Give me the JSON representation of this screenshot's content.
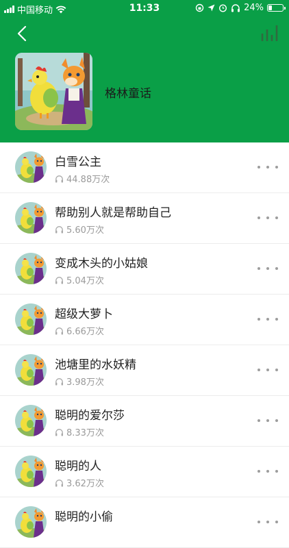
{
  "status_bar": {
    "carrier": "中国移动",
    "time": "11:33",
    "battery": "24%",
    "battery_level": 0.24
  },
  "header": {
    "album_title": "格林童话",
    "back_icon": "chevron-left-icon",
    "playing_icon": "equalizer-icon"
  },
  "colors": {
    "header_bg": "#0a9f47"
  },
  "tracks": [
    {
      "title": "白雪公主",
      "plays": "44.88万次"
    },
    {
      "title": "帮助别人就是帮助自己",
      "plays": "5.60万次"
    },
    {
      "title": "变成木头的小姑娘",
      "plays": "5.04万次"
    },
    {
      "title": "超级大萝卜",
      "plays": "6.66万次"
    },
    {
      "title": "池塘里的水妖精",
      "plays": "3.98万次"
    },
    {
      "title": "聪明的爱尔莎",
      "plays": "8.33万次"
    },
    {
      "title": "聪明的人",
      "plays": "3.62万次"
    },
    {
      "title": "聪明的小偷",
      "plays": ""
    }
  ]
}
